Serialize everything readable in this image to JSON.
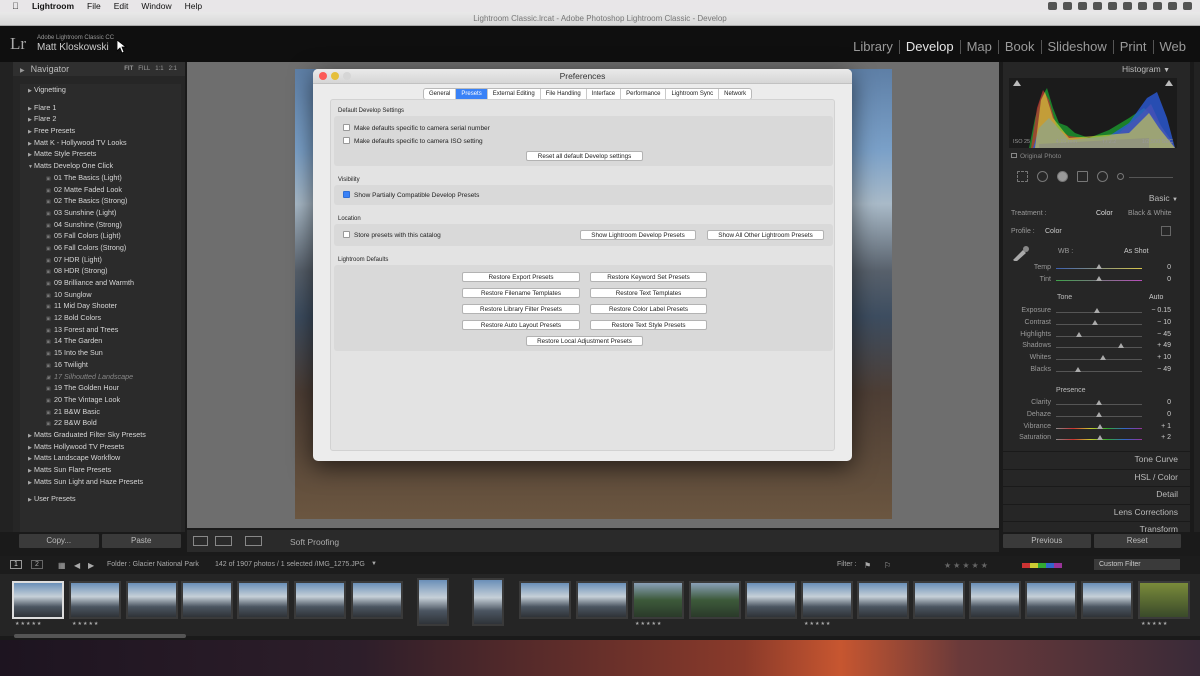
{
  "menubar": {
    "apple_icon": "apple-icon",
    "items": [
      "Lightroom",
      "File",
      "Edit",
      "Window",
      "Help"
    ]
  },
  "window_title": "Lightroom Classic.lrcat - Adobe Photoshop Lightroom Classic - Develop",
  "identity": {
    "logo": "Lr",
    "product": "Adobe Lightroom Classic CC",
    "user": "Matt Kloskowski"
  },
  "modules": [
    "Library",
    "Develop",
    "Map",
    "Book",
    "Slideshow",
    "Print",
    "Web"
  ],
  "active_module": "Develop",
  "left_panel": {
    "navigator_title": "Navigator",
    "navigator_options": [
      "FIT",
      "FILL",
      "1:1",
      "2:1"
    ],
    "presets": [
      {
        "type": "folder",
        "label": "Vignetting"
      },
      {
        "type": "gap"
      },
      {
        "type": "folder",
        "label": "Flare 1"
      },
      {
        "type": "folder",
        "label": "Flare 2"
      },
      {
        "type": "folder",
        "label": "Free Presets"
      },
      {
        "type": "folder",
        "label": "Matt K - Hollywood TV Looks"
      },
      {
        "type": "folder",
        "label": "Matte Style Presets"
      },
      {
        "type": "folder-open",
        "label": "Matts Develop One Click"
      },
      {
        "type": "item",
        "label": "01 The Basics (Light)"
      },
      {
        "type": "item",
        "label": "02 Matte Faded Look"
      },
      {
        "type": "item",
        "label": "02 The Basics (Strong)"
      },
      {
        "type": "item",
        "label": "03 Sunshine (Light)"
      },
      {
        "type": "item",
        "label": "04 Sunshine (Strong)"
      },
      {
        "type": "item",
        "label": "05 Fall Colors (Light)"
      },
      {
        "type": "item",
        "label": "06 Fall Colors (Strong)"
      },
      {
        "type": "item",
        "label": "07 HDR (Light)"
      },
      {
        "type": "item",
        "label": "08 HDR (Strong)"
      },
      {
        "type": "item",
        "label": "09 Brilliance and Warmth"
      },
      {
        "type": "item",
        "label": "10 Sunglow"
      },
      {
        "type": "item",
        "label": "11 Mid Day Shooter"
      },
      {
        "type": "item",
        "label": "12 Bold Colors"
      },
      {
        "type": "item",
        "label": "13 Forest and Trees"
      },
      {
        "type": "item",
        "label": "14 The Garden"
      },
      {
        "type": "item",
        "label": "15 Into the Sun"
      },
      {
        "type": "item",
        "label": "16 Twilight"
      },
      {
        "type": "item-italic",
        "label": "17 Silhoutted Landscape"
      },
      {
        "type": "item",
        "label": "19 The Golden Hour"
      },
      {
        "type": "item",
        "label": "20 The Vintage Look"
      },
      {
        "type": "item",
        "label": "21 B&W Basic"
      },
      {
        "type": "item",
        "label": "22 B&W Bold"
      },
      {
        "type": "folder",
        "label": "Matts Graduated Filter Sky Presets"
      },
      {
        "type": "folder",
        "label": "Matts Hollywood TV Presets"
      },
      {
        "type": "folder",
        "label": "Matts Landscape Workflow"
      },
      {
        "type": "folder",
        "label": "Matts Sun Flare Presets"
      },
      {
        "type": "folder",
        "label": "Matts Sun Light and Haze Presets"
      },
      {
        "type": "gap"
      },
      {
        "type": "folder",
        "label": "User Presets"
      }
    ],
    "copy_label": "Copy...",
    "paste_label": "Paste"
  },
  "toolbar": {
    "soft_proofing": "Soft Proofing"
  },
  "right_panel": {
    "histogram_title": "Histogram",
    "histogram_info": [
      "ISO 25",
      "4.15 mm",
      "f / 2.2",
      "1/2,500 SEC"
    ],
    "original_photo": "Original Photo",
    "basic_title": "Basic",
    "treatment_label": "Treatment :",
    "treatment_color": "Color",
    "treatment_bw": "Black & White",
    "profile_label": "Profile :",
    "profile_value": "Color",
    "wb_label": "WB :",
    "wb_value": "As Shot",
    "temp_label": "Temp",
    "temp_value": "0",
    "tint_label": "Tint",
    "tint_value": "0",
    "tone_label": "Tone",
    "tone_auto": "Auto",
    "presence_label": "Presence",
    "tone_sliders": [
      {
        "label": "Exposure",
        "value": "− 0.15",
        "pos": 0.48
      },
      {
        "label": "Contrast",
        "value": "− 10",
        "pos": 0.45
      },
      {
        "label": "Highlights",
        "value": "− 45",
        "pos": 0.27
      },
      {
        "label": "Shadows",
        "value": "+ 49",
        "pos": 0.75
      },
      {
        "label": "Whites",
        "value": "+ 10",
        "pos": 0.55
      },
      {
        "label": "Blacks",
        "value": "− 49",
        "pos": 0.26
      }
    ],
    "presence_sliders": [
      {
        "label": "Clarity",
        "value": "0",
        "pos": 0.5
      },
      {
        "label": "Dehaze",
        "value": "0",
        "pos": 0.5
      },
      {
        "label": "Vibrance",
        "value": "+ 1",
        "pos": 0.51
      },
      {
        "label": "Saturation",
        "value": "+ 2",
        "pos": 0.51
      }
    ],
    "sections": [
      "Tone Curve",
      "HSL / Color",
      "Detail",
      "Lens Corrections",
      "Transform"
    ],
    "previous_label": "Previous",
    "reset_label": "Reset"
  },
  "filmstrip": {
    "page_buttons": [
      "1",
      "2"
    ],
    "folder_text": "Folder : Glacier National Park",
    "count_text": "142 of 1907 photos / 1 selected /IMG_1275.JPG",
    "filter_label": "Filter :",
    "custom_filter": "Custom Filter"
  },
  "dialog": {
    "title": "Preferences",
    "tabs": [
      "General",
      "Presets",
      "External Editing",
      "File Handling",
      "Interface",
      "Performance",
      "Lightroom Sync",
      "Network"
    ],
    "active_tab": "Presets",
    "default_develop_title": "Default Develop Settings",
    "serial_number_label": "Make defaults specific to camera serial number",
    "iso_label": "Make defaults specific to camera ISO setting",
    "reset_defaults_label": "Reset all default Develop settings",
    "visibility_title": "Visibility",
    "show_partial_label": "Show Partially Compatible Develop Presets",
    "location_title": "Location",
    "store_presets_label": "Store presets with this catalog",
    "show_develop_presets": "Show Lightroom Develop Presets",
    "show_other_presets": "Show All Other Lightroom Presets",
    "defaults_title": "Lightroom Defaults",
    "restore_buttons_left": [
      "Restore Export Presets",
      "Restore Filename Templates",
      "Restore Library Filter Presets",
      "Restore Auto Layout Presets"
    ],
    "restore_buttons_right": [
      "Restore Keyword Set Presets",
      "Restore Text Templates",
      "Restore Color Label Presets",
      "Restore Text Style Presets"
    ],
    "restore_local": "Restore Local Adjustment Presets"
  },
  "colors": {
    "accent": "#3a82f7",
    "panel_bg": "#262626"
  }
}
